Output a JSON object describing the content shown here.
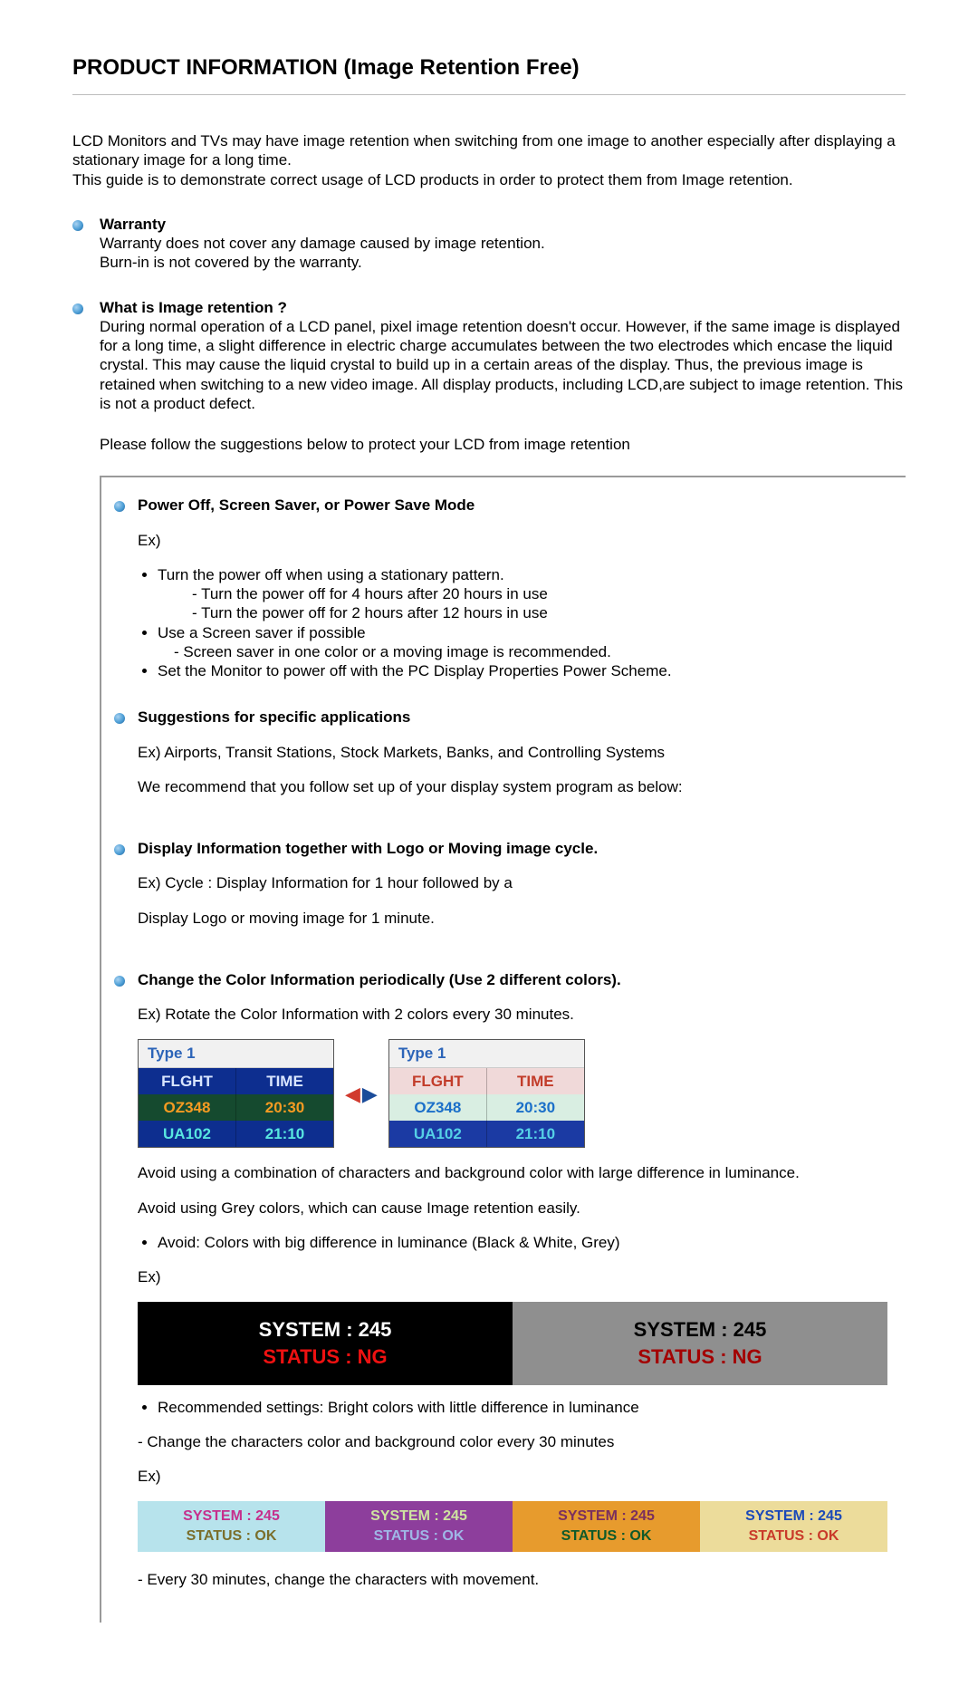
{
  "title": "PRODUCT INFORMATION (Image Retention Free)",
  "intro_l1": "LCD Monitors and TVs may have image retention when switching from one image to another especially after displaying a stationary image for a long time.",
  "intro_l2": "This guide is to demonstrate correct usage of LCD products in order to protect them from Image retention.",
  "warranty": {
    "heading": "Warranty",
    "l1": "Warranty does not cover any damage caused by image retention.",
    "l2": "Burn-in is not covered by the warranty."
  },
  "what": {
    "heading": "What is Image retention ?",
    "body": "During normal operation of a LCD panel, pixel image retention doesn't occur. However, if the same image is displayed for a long time, a slight difference in electric charge accumulates between the two electrodes which encase the liquid crystal. This may cause the liquid crystal to build up in a certain areas of the display. Thus, the previous image is retained when switching to a new video image. All display products, including LCD,are subject to image retention. This is not a product defect."
  },
  "follow_note": "Please follow the suggestions below to protect your LCD from image retention",
  "poweroff": {
    "heading": "Power Off, Screen Saver, or Power Save Mode",
    "ex": "Ex)",
    "li1": "Turn the power off when using a stationary pattern.",
    "li1a": "- Turn the power off for 4 hours after 20 hours in use",
    "li1b": "- Turn the power off for 2 hours after 12 hours in use",
    "li2": "Use a Screen saver if possible",
    "li2a": "- Screen saver in one color or a moving image is recommended.",
    "li3": "Set the Monitor to power off with the PC Display Properties Power Scheme."
  },
  "suggestions": {
    "heading": "Suggestions for specific applications",
    "l1": "Ex) Airports, Transit Stations, Stock Markets, Banks, and Controlling Systems",
    "l2": "We recommend that you follow set up of your display system program as below:"
  },
  "display_info": {
    "heading": "Display Information together with Logo or Moving image cycle.",
    "l1": "Ex) Cycle : Display Information for 1 hour followed by a",
    "l2": "Display Logo or moving image for 1 minute."
  },
  "change_color": {
    "heading": "Change the Color Information periodically (Use 2 different colors).",
    "l1": "Ex) Rotate the Color Information with 2 colors every 30 minutes."
  },
  "flight": {
    "caption": "Type 1",
    "h_flight": "FLGHT",
    "h_time": "TIME",
    "r1_f": "OZ348",
    "r1_t": "20:30",
    "r2_f": "UA102",
    "r2_t": "21:10"
  },
  "avoid": {
    "p1": "Avoid using a combination of characters and background color with large difference in luminance.",
    "p2": "Avoid using Grey colors, which can cause Image retention easily.",
    "li": "Avoid: Colors with big difference in luminance (Black & White, Grey)",
    "ex": "Ex)"
  },
  "sys_avoid": {
    "l1": "SYSTEM : 245",
    "l2": "STATUS : NG"
  },
  "rec": {
    "li": "Recommended settings: Bright colors with little difference in luminance",
    "sub": "- Change the characters color and background color every 30 minutes",
    "ex": "Ex)"
  },
  "sys_ok": {
    "l1": "SYSTEM : 245",
    "l2": "STATUS : OK"
  },
  "movement_note": "- Every 30 minutes, change the characters with movement."
}
